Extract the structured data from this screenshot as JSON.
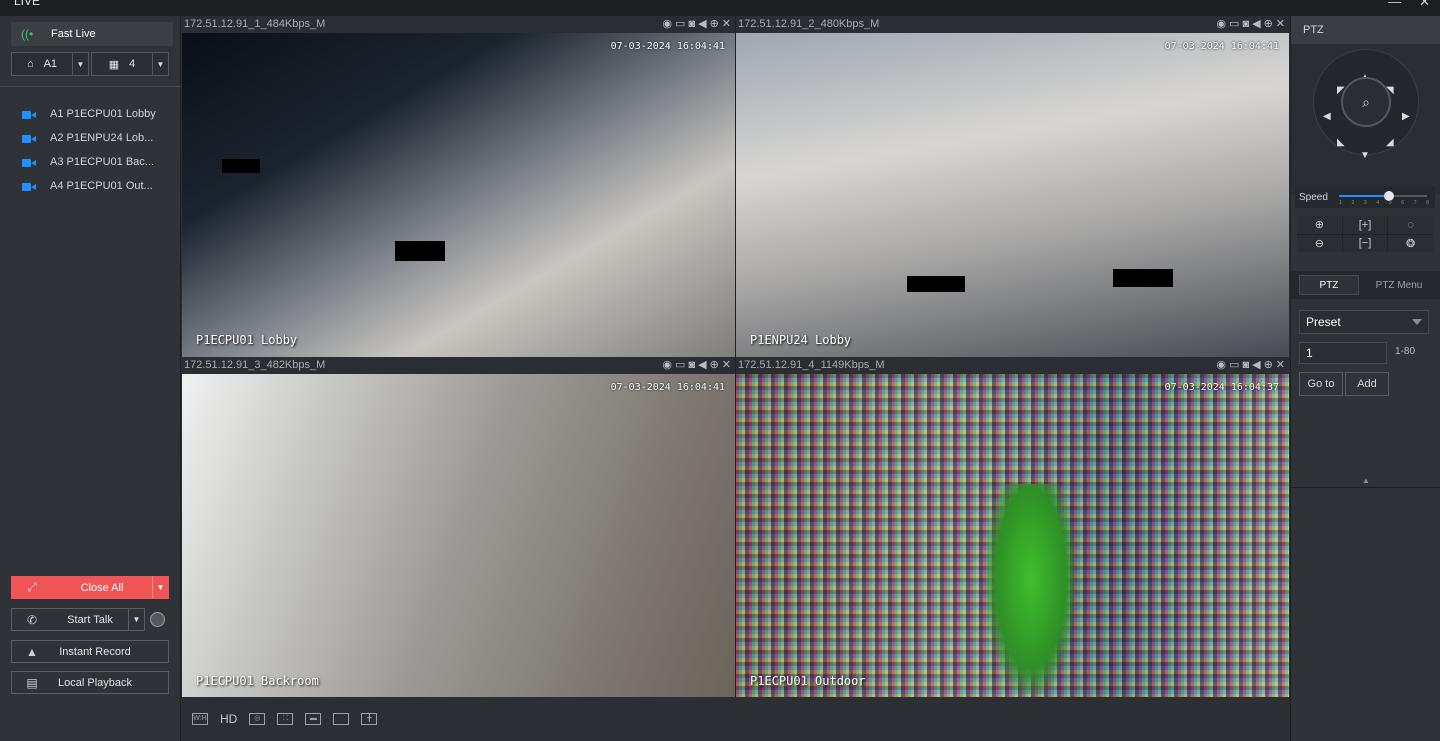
{
  "app": {
    "title": "LIVE",
    "window_controls": [
      "—",
      "✕"
    ]
  },
  "left_panel": {
    "fast_live": {
      "label": "Fast Live",
      "icon": "signal-icon"
    },
    "group_select": {
      "value": "A1",
      "icon": "dome-camera-icon"
    },
    "split_select": {
      "value": "4",
      "icon": "grid-icon"
    },
    "channels": [
      {
        "label": "A1 P1ECPU01 Lobby"
      },
      {
        "label": "A2 P1ENPU24 Lob..."
      },
      {
        "label": "A3 P1ECPU01 Bac..."
      },
      {
        "label": "A4 P1ECPU01 Out..."
      }
    ],
    "buttons": {
      "close_all": "Close All",
      "start_talk": "Start Talk",
      "instant_record": "Instant Record",
      "local_playback": "Local Playback"
    },
    "accent_color": "#f15456"
  },
  "video_cells": [
    {
      "header": "172.51.12.91_1_484Kbps_M",
      "timestamp": "07-03-2024 16:04:41",
      "name": "P1ECPU01 Lobby",
      "selected": true
    },
    {
      "header": "172.51.12.91_2_480Kbps_M",
      "timestamp": "07-03-2024 16:04:41",
      "name": "P1ENPU24 Lobby",
      "selected": false
    },
    {
      "header": "172.51.12.91_3_482Kbps_M",
      "timestamp": "07-03-2024 16:04:41",
      "name": "P1ECPU01 Backroom",
      "selected": false
    },
    {
      "header": "172.51.12.91_4_1149Kbps_M",
      "timestamp": "07-03-2024 16:04:37",
      "name": "P1ECPU01 Outdoor",
      "selected": false
    }
  ],
  "cell_header_icons": [
    "eye-icon",
    "snapshot-icon",
    "record-icon",
    "audio-icon",
    "zoom-icon",
    "close-icon"
  ],
  "bottom_toolbar": {
    "quality_label": "HD",
    "icons": [
      "aspect-ratio-icon",
      "fisheye-icon",
      "fullscreen-icon",
      "single-view-icon",
      "1-split-icon",
      "4-split-icon"
    ]
  },
  "ptz": {
    "header": "PTZ",
    "speed_label": "Speed",
    "speed_ticks": [
      "1",
      "2",
      "3",
      "4",
      "5",
      "6",
      "7",
      "8"
    ],
    "speed_value": 5,
    "tabs": [
      "PTZ",
      "PTZ Menu"
    ],
    "preset_select": "Preset",
    "preset_value": "1",
    "preset_range": "1-80",
    "goto_label": "Go to",
    "add_label": "Add"
  }
}
